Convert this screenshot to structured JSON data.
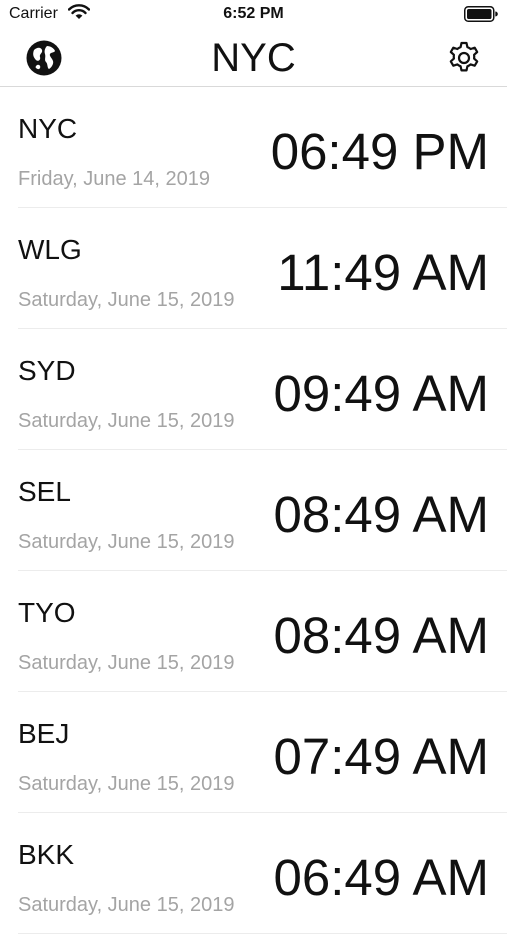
{
  "status_bar": {
    "carrier": "Carrier",
    "time": "6:52 PM"
  },
  "nav": {
    "title": "NYC",
    "left_icon": "globe-icon",
    "right_icon": "gear-icon"
  },
  "rows": [
    {
      "code": "NYC",
      "date": "Friday, June 14, 2019",
      "time": "06:49 PM"
    },
    {
      "code": "WLG",
      "date": "Saturday, June 15, 2019",
      "time": "11:49 AM"
    },
    {
      "code": "SYD",
      "date": "Saturday, June 15, 2019",
      "time": "09:49 AM"
    },
    {
      "code": "SEL",
      "date": "Saturday, June 15, 2019",
      "time": "08:49 AM"
    },
    {
      "code": "TYO",
      "date": "Saturday, June 15, 2019",
      "time": "08:49 AM"
    },
    {
      "code": "BEJ",
      "date": "Saturday, June 15, 2019",
      "time": "07:49 AM"
    },
    {
      "code": "BKK",
      "date": "Saturday, June 15, 2019",
      "time": "06:49 AM"
    }
  ]
}
